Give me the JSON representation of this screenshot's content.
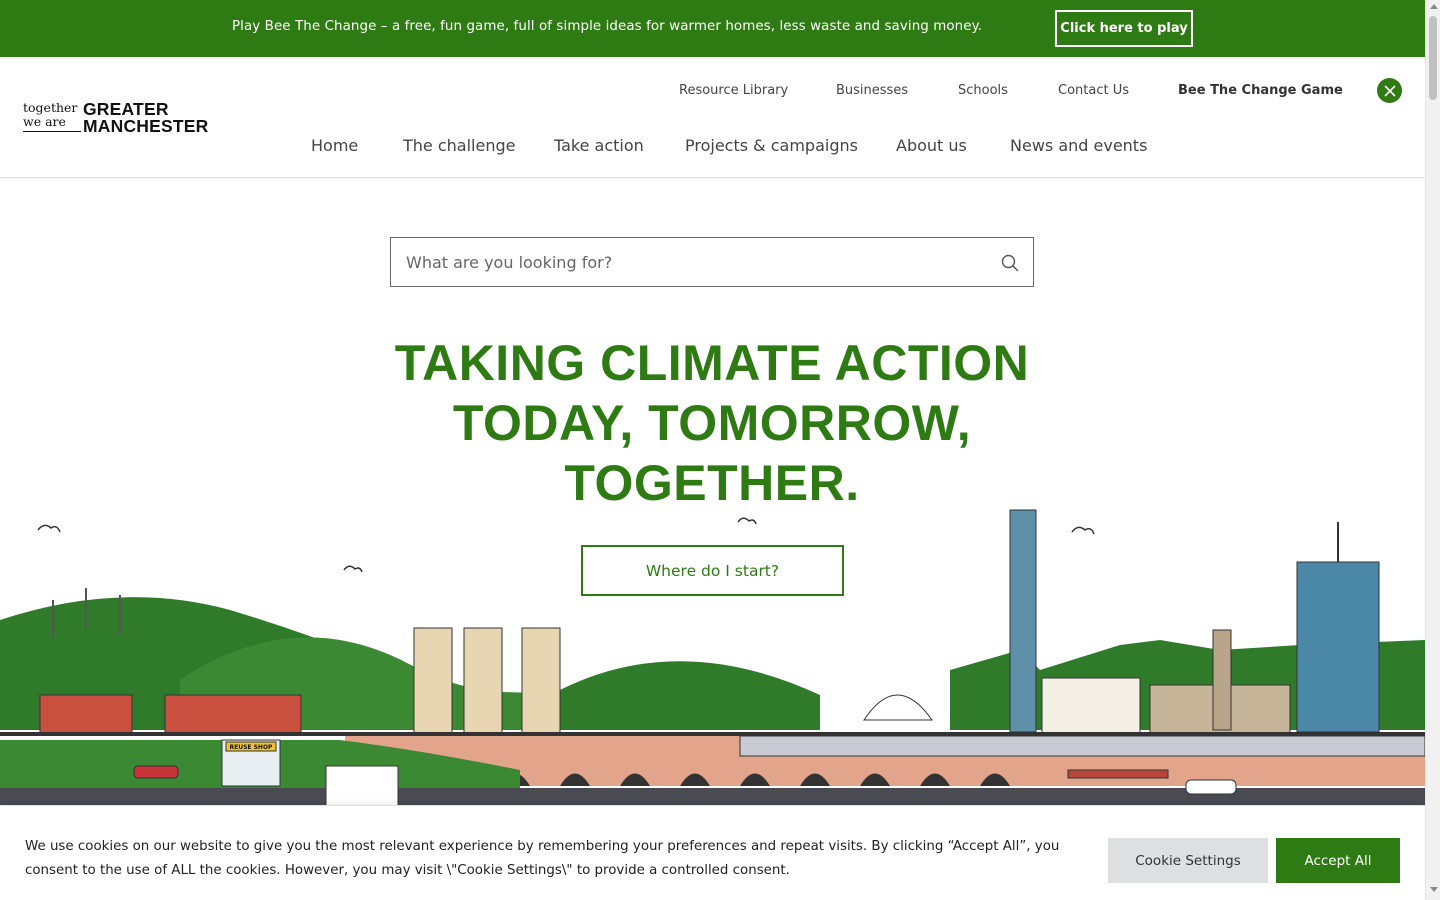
{
  "promo": {
    "text": "Play Bee The Change – a free, fun game, full of simple ideas for warmer homes, less waste and saving money.",
    "button": "Click here to play"
  },
  "logo": {
    "small_line1": "together",
    "small_line2": "we are",
    "big_line1": "GREATER",
    "big_line2": "MANCHESTER"
  },
  "utility_nav": [
    "Resource Library",
    "Businesses",
    "Schools",
    "Contact Us",
    "Bee The Change Game"
  ],
  "main_nav": [
    "Home",
    "The challenge",
    "Take action",
    "Projects & campaigns",
    "About us",
    "News and events"
  ],
  "search": {
    "placeholder": "What are you looking for?"
  },
  "hero": {
    "line1": "TAKING CLIMATE ACTION",
    "line2": "TODAY, TOMORROW,",
    "line3": "TOGETHER.",
    "cta": "Where do I start?"
  },
  "illustration": {
    "reuse_shop_sign": "REUSE SHOP"
  },
  "cookie": {
    "text": "We use cookies on our website to give you the most relevant experience by remembering your preferences and repeat visits. By clicking “Accept All”, you consent to the use of ALL the cookies. However, you may visit \\\"Cookie Settings\\\" to provide a controlled consent.",
    "settings_button": "Cookie Settings",
    "accept_button": "Accept All"
  },
  "colors": {
    "brand_green": "#2e7b13",
    "hill_green": "#2e7a2b",
    "cookie_settings_bg": "#dedfe0"
  },
  "icons": [
    "search-icon",
    "x-twitter-icon"
  ]
}
